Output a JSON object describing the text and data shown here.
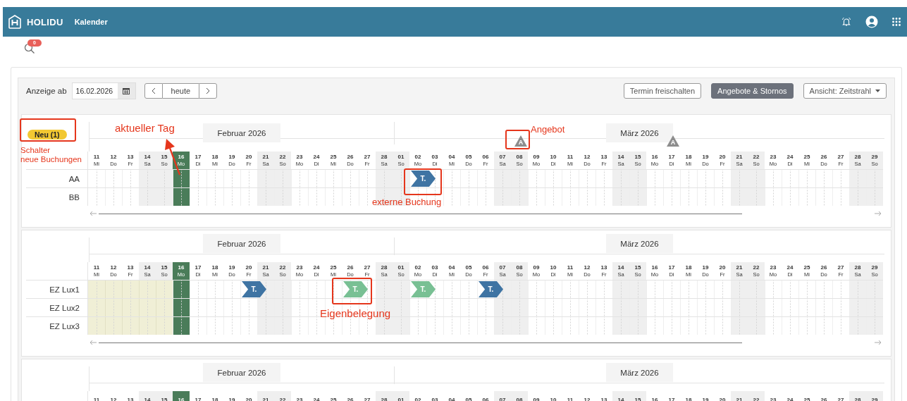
{
  "header": {
    "brand": "HOLIDU",
    "title": "Kalender"
  },
  "search": {
    "badge": "0"
  },
  "toolbar": {
    "label": "Anzeige ab",
    "date": "16.02.2026",
    "today_button": "heute",
    "buttons": [
      {
        "label": "Termin freischalten",
        "selected": false
      },
      {
        "label": "Angebote & Stornos",
        "selected": true
      }
    ],
    "view_select": "Ansicht: Zeitstrahl"
  },
  "calendars": [
    {
      "new_badge": "Neu (1)",
      "months": [
        {
          "label": "Februar 2026",
          "days": [
            {
              "day": "11",
              "weekday": "Mi",
              "weekend": false,
              "today": false,
              "blocked": false
            },
            {
              "day": "12",
              "weekday": "Do",
              "weekend": false,
              "today": false,
              "blocked": false
            },
            {
              "day": "13",
              "weekday": "Fr",
              "weekend": false,
              "today": false,
              "blocked": false
            },
            {
              "day": "14",
              "weekday": "Sa",
              "weekend": true,
              "today": false,
              "blocked": false
            },
            {
              "day": "15",
              "weekday": "So",
              "weekend": true,
              "today": false,
              "blocked": false
            },
            {
              "day": "16",
              "weekday": "Mo",
              "weekend": false,
              "today": true,
              "blocked": false
            },
            {
              "day": "17",
              "weekday": "Di",
              "weekend": false,
              "today": false,
              "blocked": false
            },
            {
              "day": "18",
              "weekday": "Mi",
              "weekend": false,
              "today": false,
              "blocked": false
            },
            {
              "day": "19",
              "weekday": "Do",
              "weekend": false,
              "today": false,
              "blocked": false
            },
            {
              "day": "20",
              "weekday": "Fr",
              "weekend": false,
              "today": false,
              "blocked": false
            },
            {
              "day": "21",
              "weekday": "Sa",
              "weekend": true,
              "today": false,
              "blocked": false
            },
            {
              "day": "22",
              "weekday": "So",
              "weekend": true,
              "today": false,
              "blocked": false
            },
            {
              "day": "23",
              "weekday": "Mo",
              "weekend": false,
              "today": false,
              "blocked": false
            },
            {
              "day": "24",
              "weekday": "Di",
              "weekend": false,
              "today": false,
              "blocked": false
            },
            {
              "day": "25",
              "weekday": "Mi",
              "weekend": false,
              "today": false,
              "blocked": false
            },
            {
              "day": "26",
              "weekday": "Do",
              "weekend": false,
              "today": false,
              "blocked": false
            },
            {
              "day": "27",
              "weekday": "Fr",
              "weekend": false,
              "today": false,
              "blocked": false
            },
            {
              "day": "28",
              "weekday": "Sa",
              "weekend": true,
              "today": false,
              "blocked": false
            }
          ]
        },
        {
          "label": "März 2026",
          "days": [
            {
              "day": "01",
              "weekday": "So",
              "weekend": true,
              "today": false,
              "blocked": false
            },
            {
              "day": "02",
              "weekday": "Mo",
              "weekend": false,
              "today": false,
              "blocked": false
            },
            {
              "day": "03",
              "weekday": "Di",
              "weekend": false,
              "today": false,
              "blocked": false
            },
            {
              "day": "04",
              "weekday": "Mi",
              "weekend": false,
              "today": false,
              "blocked": false
            },
            {
              "day": "05",
              "weekday": "Do",
              "weekend": false,
              "today": false,
              "blocked": false
            },
            {
              "day": "06",
              "weekday": "Fr",
              "weekend": false,
              "today": false,
              "blocked": false
            },
            {
              "day": "07",
              "weekday": "Sa",
              "weekend": true,
              "today": false,
              "blocked": false
            },
            {
              "day": "08",
              "weekday": "So",
              "weekend": true,
              "today": false,
              "blocked": false,
              "offer": {
                "label": "A"
              }
            },
            {
              "day": "09",
              "weekday": "Mo",
              "weekend": false,
              "today": false,
              "blocked": false
            },
            {
              "day": "10",
              "weekday": "Di",
              "weekend": false,
              "today": false,
              "blocked": false
            },
            {
              "day": "11",
              "weekday": "Mi",
              "weekend": false,
              "today": false,
              "blocked": false
            },
            {
              "day": "12",
              "weekday": "Do",
              "weekend": false,
              "today": false,
              "blocked": false
            },
            {
              "day": "13",
              "weekday": "Fr",
              "weekend": false,
              "today": false,
              "blocked": false
            },
            {
              "day": "14",
              "weekday": "Sa",
              "weekend": true,
              "today": false,
              "blocked": false
            },
            {
              "day": "15",
              "weekday": "So",
              "weekend": true,
              "today": false,
              "blocked": false
            },
            {
              "day": "16",
              "weekday": "Mo",
              "weekend": false,
              "today": false,
              "blocked": false
            },
            {
              "day": "17",
              "weekday": "Di",
              "weekend": false,
              "today": false,
              "blocked": false,
              "offer": {
                "label": "A"
              }
            },
            {
              "day": "18",
              "weekday": "Mi",
              "weekend": false,
              "today": false,
              "blocked": false
            },
            {
              "day": "19",
              "weekday": "Do",
              "weekend": false,
              "today": false,
              "blocked": false
            },
            {
              "day": "20",
              "weekday": "Fr",
              "weekend": false,
              "today": false,
              "blocked": false
            },
            {
              "day": "21",
              "weekday": "Sa",
              "weekend": true,
              "today": false,
              "blocked": false
            },
            {
              "day": "22",
              "weekday": "So",
              "weekend": true,
              "today": false,
              "blocked": false
            },
            {
              "day": "23",
              "weekday": "Mo",
              "weekend": false,
              "today": false,
              "blocked": false
            },
            {
              "day": "24",
              "weekday": "Di",
              "weekend": false,
              "today": false,
              "blocked": false
            },
            {
              "day": "25",
              "weekday": "Mi",
              "weekend": false,
              "today": false,
              "blocked": false
            },
            {
              "day": "26",
              "weekday": "Do",
              "weekend": false,
              "today": false,
              "blocked": false
            },
            {
              "day": "27",
              "weekday": "Fr",
              "weekend": false,
              "today": false,
              "blocked": false
            },
            {
              "day": "28",
              "weekday": "Sa",
              "weekend": true,
              "today": false,
              "blocked": false
            },
            {
              "day": "29",
              "weekday": "So",
              "weekend": true,
              "today": false,
              "blocked": false
            }
          ]
        }
      ],
      "rows": [
        {
          "name": "AA",
          "slots": [
            {
              "kind": "free"
            },
            {
              "kind": "free"
            },
            {
              "kind": "free"
            },
            {
              "kind": "free"
            },
            {
              "kind": "free"
            },
            {
              "kind": "free"
            },
            {
              "kind": "free"
            },
            {
              "kind": "free"
            },
            {
              "kind": "free"
            },
            {
              "kind": "free"
            },
            {
              "kind": "free"
            },
            {
              "kind": "free"
            },
            {
              "kind": "free"
            },
            {
              "kind": "free"
            },
            {
              "kind": "free"
            },
            {
              "kind": "free"
            },
            {
              "kind": "free"
            },
            {
              "kind": "free"
            },
            {
              "kind": "free"
            },
            {
              "label": "T.",
              "kind": "external"
            },
            {
              "kind": "free"
            },
            {
              "kind": "free"
            },
            {
              "kind": "free"
            },
            {
              "kind": "free"
            },
            {
              "kind": "free"
            },
            {
              "kind": "free"
            },
            {
              "kind": "free"
            },
            {
              "kind": "free"
            },
            {
              "kind": "free"
            },
            {
              "kind": "free"
            },
            {
              "kind": "free"
            },
            {
              "kind": "free"
            },
            {
              "kind": "free"
            },
            {
              "kind": "free"
            },
            {
              "kind": "free"
            },
            {
              "kind": "free"
            },
            {
              "kind": "free"
            },
            {
              "kind": "free"
            },
            {
              "kind": "free"
            },
            {
              "kind": "free"
            },
            {
              "kind": "free"
            },
            {
              "kind": "free"
            },
            {
              "kind": "free"
            },
            {
              "kind": "free"
            },
            {
              "kind": "free"
            },
            {
              "kind": "free"
            },
            {
              "kind": "free"
            }
          ]
        },
        {
          "name": "BB"
        }
      ]
    },
    {
      "months": [
        {
          "label": "Februar 2026",
          "days": [
            {
              "day": "11",
              "weekday": "Mi",
              "weekend": false,
              "today": false,
              "blocked": true
            },
            {
              "day": "12",
              "weekday": "Do",
              "weekend": false,
              "today": false,
              "blocked": true
            },
            {
              "day": "13",
              "weekday": "Fr",
              "weekend": false,
              "today": false,
              "blocked": true
            },
            {
              "day": "14",
              "weekday": "Sa",
              "weekend": true,
              "today": false,
              "blocked": true
            },
            {
              "day": "15",
              "weekday": "So",
              "weekend": true,
              "today": false,
              "blocked": true
            },
            {
              "day": "16",
              "weekday": "Mo",
              "weekend": false,
              "today": true,
              "blocked": false
            },
            {
              "day": "17",
              "weekday": "Di",
              "weekend": false,
              "today": false,
              "blocked": false
            },
            {
              "day": "18",
              "weekday": "Mi",
              "weekend": false,
              "today": false,
              "blocked": false
            },
            {
              "day": "19",
              "weekday": "Do",
              "weekend": false,
              "today": false,
              "blocked": false
            },
            {
              "day": "20",
              "weekday": "Fr",
              "weekend": false,
              "today": false,
              "blocked": false
            },
            {
              "day": "21",
              "weekday": "Sa",
              "weekend": true,
              "today": false,
              "blocked": false
            },
            {
              "day": "22",
              "weekday": "So",
              "weekend": true,
              "today": false,
              "blocked": false
            },
            {
              "day": "23",
              "weekday": "Mo",
              "weekend": false,
              "today": false,
              "blocked": false
            },
            {
              "day": "24",
              "weekday": "Di",
              "weekend": false,
              "today": false,
              "blocked": false
            },
            {
              "day": "25",
              "weekday": "Mi",
              "weekend": false,
              "today": false,
              "blocked": false
            },
            {
              "day": "26",
              "weekday": "Do",
              "weekend": false,
              "today": false,
              "blocked": false
            },
            {
              "day": "27",
              "weekday": "Fr",
              "weekend": false,
              "today": false,
              "blocked": false
            },
            {
              "day": "28",
              "weekday": "Sa",
              "weekend": true,
              "today": false,
              "blocked": false
            }
          ]
        },
        {
          "label": "März 2026",
          "days": [
            {
              "day": "01",
              "weekday": "So",
              "weekend": true,
              "today": false,
              "blocked": false
            },
            {
              "day": "02",
              "weekday": "Mo",
              "weekend": false,
              "today": false,
              "blocked": false
            },
            {
              "day": "03",
              "weekday": "Di",
              "weekend": false,
              "today": false,
              "blocked": false
            },
            {
              "day": "04",
              "weekday": "Mi",
              "weekend": false,
              "today": false,
              "blocked": false
            },
            {
              "day": "05",
              "weekday": "Do",
              "weekend": false,
              "today": false,
              "blocked": false
            },
            {
              "day": "06",
              "weekday": "Fr",
              "weekend": false,
              "today": false,
              "blocked": false
            },
            {
              "day": "07",
              "weekday": "Sa",
              "weekend": true,
              "today": false,
              "blocked": false
            },
            {
              "day": "08",
              "weekday": "So",
              "weekend": true,
              "today": false,
              "blocked": false
            },
            {
              "day": "09",
              "weekday": "Mo",
              "weekend": false,
              "today": false,
              "blocked": false
            },
            {
              "day": "10",
              "weekday": "Di",
              "weekend": false,
              "today": false,
              "blocked": false
            },
            {
              "day": "11",
              "weekday": "Mi",
              "weekend": false,
              "today": false,
              "blocked": false
            },
            {
              "day": "12",
              "weekday": "Do",
              "weekend": false,
              "today": false,
              "blocked": false
            },
            {
              "day": "13",
              "weekday": "Fr",
              "weekend": false,
              "today": false,
              "blocked": false
            },
            {
              "day": "14",
              "weekday": "Sa",
              "weekend": true,
              "today": false,
              "blocked": false
            },
            {
              "day": "15",
              "weekday": "So",
              "weekend": true,
              "today": false,
              "blocked": false
            },
            {
              "day": "16",
              "weekday": "Mo",
              "weekend": false,
              "today": false,
              "blocked": false
            },
            {
              "day": "17",
              "weekday": "Di",
              "weekend": false,
              "today": false,
              "blocked": false
            },
            {
              "day": "18",
              "weekday": "Mi",
              "weekend": false,
              "today": false,
              "blocked": false
            },
            {
              "day": "19",
              "weekday": "Do",
              "weekend": false,
              "today": false,
              "blocked": false
            },
            {
              "day": "20",
              "weekday": "Fr",
              "weekend": false,
              "today": false,
              "blocked": false
            },
            {
              "day": "21",
              "weekday": "Sa",
              "weekend": true,
              "today": false,
              "blocked": false
            },
            {
              "day": "22",
              "weekday": "So",
              "weekend": true,
              "today": false,
              "blocked": false
            },
            {
              "day": "23",
              "weekday": "Mo",
              "weekend": false,
              "today": false,
              "blocked": false
            },
            {
              "day": "24",
              "weekday": "Di",
              "weekend": false,
              "today": false,
              "blocked": false
            },
            {
              "day": "25",
              "weekday": "Mi",
              "weekend": false,
              "today": false,
              "blocked": false
            },
            {
              "day": "26",
              "weekday": "Do",
              "weekend": false,
              "today": false,
              "blocked": false
            },
            {
              "day": "27",
              "weekday": "Fr",
              "weekend": false,
              "today": false,
              "blocked": false
            },
            {
              "day": "28",
              "weekday": "Sa",
              "weekend": true,
              "today": false,
              "blocked": false
            },
            {
              "day": "29",
              "weekday": "So",
              "weekend": true,
              "today": false,
              "blocked": false
            }
          ]
        }
      ],
      "rows": [
        {
          "name": "EZ Lux1",
          "slots": [
            {
              "kind": "free"
            },
            {
              "kind": "free"
            },
            {
              "kind": "free"
            },
            {
              "kind": "free"
            },
            {
              "kind": "free"
            },
            {
              "kind": "free"
            },
            {
              "kind": "free"
            },
            {
              "kind": "free"
            },
            {
              "kind": "free"
            },
            {
              "label": "T.",
              "kind": "external"
            },
            {
              "kind": "free"
            },
            {
              "kind": "free"
            },
            {
              "kind": "free"
            },
            {
              "kind": "free"
            },
            {
              "kind": "free"
            },
            {
              "label": "T.",
              "kind": "own"
            },
            {
              "kind": "free"
            },
            {
              "kind": "free"
            },
            {
              "kind": "free"
            },
            {
              "label": "T.",
              "kind": "own"
            },
            {
              "kind": "free"
            },
            {
              "kind": "free"
            },
            {
              "kind": "free"
            },
            {
              "label": "T.",
              "kind": "external"
            },
            {
              "kind": "free"
            },
            {
              "kind": "free"
            },
            {
              "kind": "free"
            },
            {
              "kind": "free"
            },
            {
              "kind": "free"
            },
            {
              "kind": "free"
            },
            {
              "kind": "free"
            },
            {
              "kind": "free"
            },
            {
              "kind": "free"
            },
            {
              "kind": "free"
            },
            {
              "kind": "free"
            },
            {
              "kind": "free"
            },
            {
              "kind": "free"
            },
            {
              "kind": "free"
            },
            {
              "kind": "free"
            },
            {
              "kind": "free"
            },
            {
              "kind": "free"
            },
            {
              "kind": "free"
            },
            {
              "kind": "free"
            },
            {
              "kind": "free"
            },
            {
              "kind": "free"
            },
            {
              "kind": "free"
            },
            {
              "kind": "free"
            }
          ]
        },
        {
          "name": "EZ Lux2"
        },
        {
          "name": "EZ Lux3"
        }
      ]
    },
    {
      "months": [
        {
          "label": "Februar 2026",
          "days": [
            {
              "day": "11",
              "weekend": false,
              "today": false
            },
            {
              "day": "12",
              "weekend": false,
              "today": false
            },
            {
              "day": "13",
              "weekend": false,
              "today": false
            },
            {
              "day": "14",
              "weekend": true,
              "today": false
            },
            {
              "day": "15",
              "weekend": true,
              "today": false
            },
            {
              "day": "16",
              "weekend": false,
              "today": true
            },
            {
              "day": "17",
              "weekend": false,
              "today": false
            },
            {
              "day": "18",
              "weekend": false,
              "today": false
            },
            {
              "day": "19",
              "weekend": false,
              "today": false
            },
            {
              "day": "20",
              "weekend": false,
              "today": false
            },
            {
              "day": "21",
              "weekend": true,
              "today": false
            },
            {
              "day": "22",
              "weekend": true,
              "today": false
            },
            {
              "day": "23",
              "weekend": false,
              "today": false
            },
            {
              "day": "24",
              "weekend": false,
              "today": false
            },
            {
              "day": "25",
              "weekend": false,
              "today": false
            },
            {
              "day": "26",
              "weekend": false,
              "today": false
            },
            {
              "day": "27",
              "weekend": false,
              "today": false
            },
            {
              "day": "28",
              "weekend": true,
              "today": false
            }
          ]
        },
        {
          "label": "März 2026",
          "days": [
            {
              "day": "01",
              "weekend": true,
              "today": false
            },
            {
              "day": "02",
              "weekend": false,
              "today": false
            },
            {
              "day": "03",
              "weekend": false,
              "today": false
            },
            {
              "day": "04",
              "weekend": false,
              "today": false
            },
            {
              "day": "05",
              "weekend": false,
              "today": false
            },
            {
              "day": "06",
              "weekend": false,
              "today": false
            },
            {
              "day": "07",
              "weekend": true,
              "today": false
            },
            {
              "day": "08",
              "weekend": true,
              "today": false
            },
            {
              "day": "09",
              "weekend": false,
              "today": false
            },
            {
              "day": "10",
              "weekend": false,
              "today": false
            },
            {
              "day": "11",
              "weekend": false,
              "today": false
            },
            {
              "day": "12",
              "weekend": false,
              "today": false
            },
            {
              "day": "13",
              "weekend": false,
              "today": false
            },
            {
              "day": "14",
              "weekend": true,
              "today": false
            },
            {
              "day": "15",
              "weekend": true,
              "today": false
            },
            {
              "day": "16",
              "weekend": false,
              "today": false
            },
            {
              "day": "17",
              "weekend": false,
              "today": false
            },
            {
              "day": "18",
              "weekend": false,
              "today": false
            },
            {
              "day": "19",
              "weekend": false,
              "today": false
            },
            {
              "day": "20",
              "weekend": false,
              "today": false
            },
            {
              "day": "21",
              "weekend": true,
              "today": false
            },
            {
              "day": "22",
              "weekend": true,
              "today": false
            },
            {
              "day": "23",
              "weekend": false,
              "today": false
            },
            {
              "day": "24",
              "weekend": false,
              "today": false
            },
            {
              "day": "25",
              "weekend": false,
              "today": false
            },
            {
              "day": "26",
              "weekend": false,
              "today": false
            },
            {
              "day": "27",
              "weekend": false,
              "today": false
            },
            {
              "day": "28",
              "weekend": true,
              "today": false
            },
            {
              "day": "29",
              "weekend": true,
              "today": false
            }
          ]
        }
      ]
    }
  ],
  "annotations": [
    {
      "kind": "box"
    },
    {
      "kind": "label",
      "text": "Schalter\nneue Buchungen"
    },
    {
      "kind": "label",
      "text": "aktueller Tag"
    },
    {
      "kind": "arrow"
    },
    {
      "kind": "box"
    },
    {
      "kind": "label",
      "text": "externe Buchung"
    },
    {
      "kind": "box"
    },
    {
      "kind": "label",
      "text": "Angebot"
    },
    {
      "kind": "box"
    },
    {
      "kind": "label",
      "text": "Eigenbelegung"
    }
  ]
}
